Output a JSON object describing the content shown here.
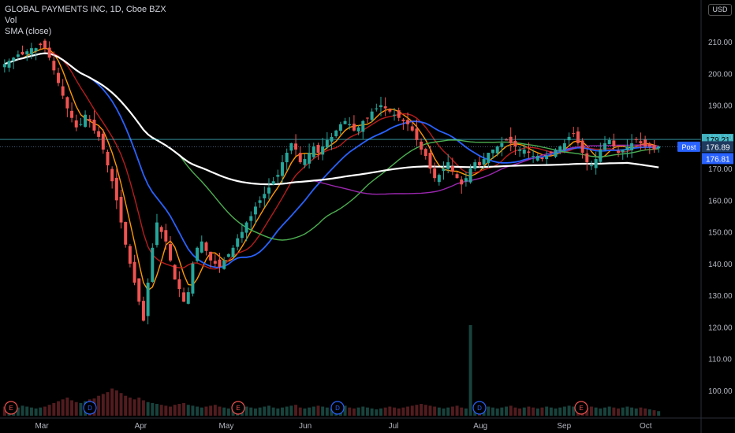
{
  "legend": {
    "symbol": "GLOBAL PAYMENTS INC, 1D, Cboe BZX",
    "vol": "Vol",
    "sma": "SMA (close)"
  },
  "currency_button": "USD",
  "colors": {
    "up": "#26a69a",
    "down": "#ef5350",
    "sma_fast": "#ff9800",
    "sma_dark_red": "#b71c1c",
    "sma_blue": "#2962ff",
    "sma_green": "#4caf50",
    "sma_purple": "#9c27b0",
    "sma_white": "#ffffff",
    "price_line": "#4dd0e1"
  },
  "chart_data": {
    "type": "candlestick",
    "y_range": [
      96,
      215
    ],
    "grid": false,
    "y_ticks": [
      "210.00",
      "200.00",
      "190.00",
      "180.00",
      "170.00",
      "160.00",
      "150.00",
      "140.00",
      "130.00",
      "120.00",
      "110.00",
      "100.00"
    ],
    "x_ticks": [
      "Mar",
      "Apr",
      "May",
      "Jun",
      "Jul",
      "Aug",
      "Sep",
      "Oct"
    ],
    "price_labels": [
      {
        "text": "179.21",
        "kind": "high-line"
      },
      {
        "text": "Post",
        "kind": "post-badge"
      },
      {
        "text": "176.89",
        "kind": "post-price"
      },
      {
        "text": "176.81",
        "kind": "last-price"
      }
    ],
    "events": [
      {
        "label": "E",
        "kind": "earnings"
      },
      {
        "label": "D",
        "kind": "dividend"
      },
      {
        "label": "E",
        "kind": "earnings"
      },
      {
        "label": "D",
        "kind": "dividend"
      },
      {
        "label": "D",
        "kind": "dividend"
      },
      {
        "label": "E",
        "kind": "earnings"
      },
      {
        "label": "D",
        "kind": "dividend"
      }
    ],
    "closes": [
      203,
      204,
      205,
      206,
      206,
      207,
      208,
      208,
      209,
      208,
      205,
      201,
      197,
      193,
      189,
      186,
      183,
      184,
      187,
      185,
      182,
      180,
      176,
      171,
      166,
      160,
      153,
      146,
      140,
      134,
      128,
      122,
      134,
      145,
      153,
      150,
      147,
      141,
      135,
      132,
      128,
      131,
      140,
      145,
      147,
      144,
      141,
      140,
      139,
      141,
      143,
      145,
      148,
      150,
      153,
      155,
      158,
      160,
      162,
      164,
      166,
      168,
      172,
      175,
      178,
      176,
      172,
      173,
      175,
      177,
      175,
      177,
      179,
      180,
      182,
      184,
      185,
      184,
      182,
      183,
      185,
      186,
      188,
      189,
      190,
      189,
      188,
      187,
      186,
      185,
      184,
      182,
      179,
      176,
      174,
      170,
      167,
      168,
      170,
      172,
      169,
      167,
      165,
      167,
      170,
      172,
      171,
      173,
      175,
      176,
      177,
      178,
      179,
      178,
      177,
      176,
      176,
      175,
      174,
      174,
      173,
      174,
      175,
      176,
      177,
      178,
      180,
      181,
      178,
      175,
      172,
      171,
      173,
      176,
      178,
      179,
      177,
      175,
      176,
      177,
      178,
      179,
      178,
      177,
      177,
      176,
      177
    ],
    "volumes": [
      10,
      9,
      8,
      9,
      11,
      10,
      9,
      8,
      9,
      10,
      12,
      14,
      16,
      18,
      20,
      17,
      15,
      14,
      16,
      18,
      19,
      22,
      24,
      26,
      30,
      28,
      25,
      22,
      20,
      18,
      20,
      17,
      15,
      14,
      13,
      12,
      11,
      10,
      12,
      13,
      14,
      12,
      11,
      10,
      9,
      10,
      11,
      12,
      10,
      9,
      8,
      10,
      12,
      11,
      10,
      9,
      8,
      9,
      10,
      11,
      9,
      8,
      9,
      10,
      11,
      12,
      9,
      8,
      9,
      10,
      11,
      10,
      9,
      8,
      9,
      10,
      11,
      9,
      8,
      9,
      10,
      9,
      8,
      7,
      8,
      9,
      10,
      9,
      8,
      9,
      10,
      11,
      12,
      13,
      12,
      11,
      10,
      9,
      8,
      9,
      10,
      11,
      9,
      8,
      100,
      9,
      8,
      9,
      10,
      9,
      8,
      9,
      10,
      11,
      9,
      8,
      9,
      10,
      9,
      8,
      9,
      10,
      9,
      8,
      9,
      10,
      11,
      10,
      9,
      8,
      9,
      10,
      9,
      8,
      9,
      10,
      9,
      8,
      9,
      10,
      9,
      8,
      9,
      8,
      7,
      6,
      5
    ]
  }
}
